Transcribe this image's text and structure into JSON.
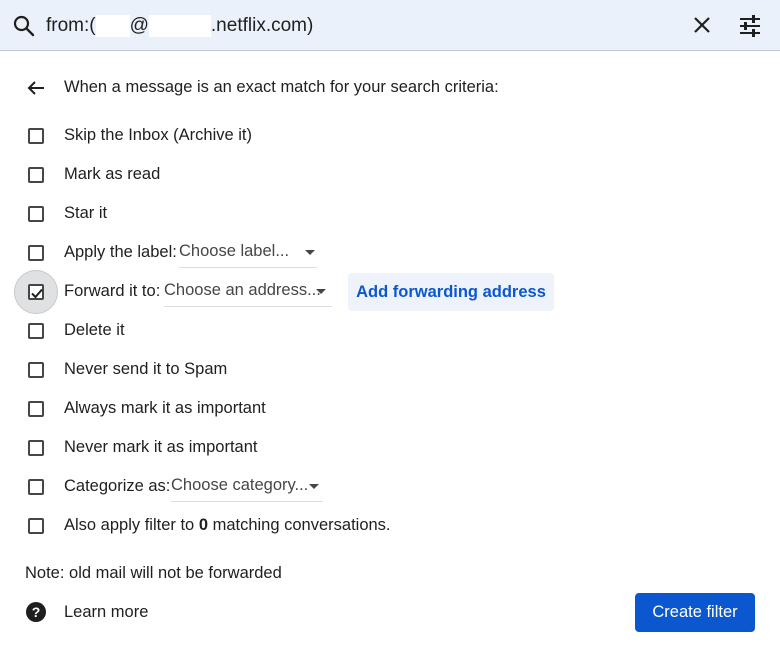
{
  "search": {
    "query_prefix": "from:(",
    "query_at": "@",
    "query_suffix": ".netflix.com)",
    "icons": [
      "search-icon",
      "close-icon",
      "tune-icon"
    ]
  },
  "header": {
    "back_icon": "arrow-back-icon",
    "title": "When a message is an exact match for your search criteria:"
  },
  "options": [
    {
      "label": "Skip the Inbox (Archive it)",
      "checked": false
    },
    {
      "label": "Mark as read",
      "checked": false
    },
    {
      "label": "Star it",
      "checked": false
    },
    {
      "label": "Apply the label:",
      "checked": false,
      "select": "Choose label..."
    },
    {
      "label": "Forward it to:",
      "checked": true,
      "select": "Choose an address...",
      "button": "Add forwarding address"
    },
    {
      "label": "Delete it",
      "checked": false
    },
    {
      "label": "Never send it to Spam",
      "checked": false
    },
    {
      "label": "Always mark it as important",
      "checked": false
    },
    {
      "label": "Never mark it as important",
      "checked": false
    },
    {
      "label": "Categorize as:",
      "checked": false,
      "select": "Choose category..."
    },
    {
      "label_before": "Also apply filter to ",
      "count": "0",
      "label_after": " matching conversations.",
      "checked": false
    }
  ],
  "footer": {
    "note": "Note: old mail will not be forwarded",
    "learn_more": "Learn more",
    "create_filter": "Create filter"
  },
  "colors": {
    "search_bg": "#eaf1fb",
    "accent": "#0b57d0",
    "button_tonal_bg": "#eef3fb"
  }
}
